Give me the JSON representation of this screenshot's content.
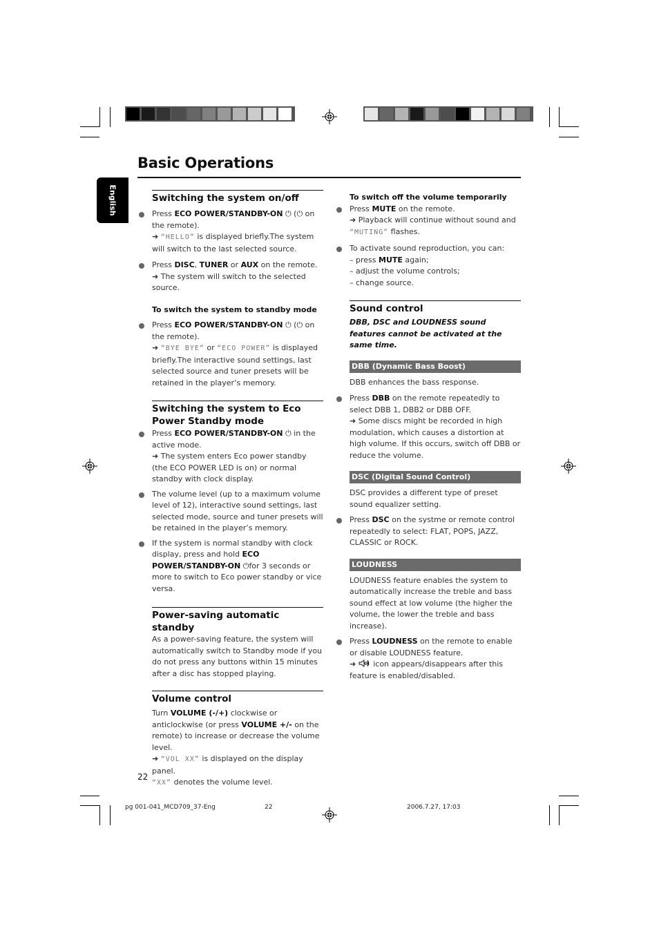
{
  "print_marks": {
    "left_swatches": [
      "#000000",
      "#1a1a1a",
      "#333333",
      "#4d4d4d",
      "#666666",
      "#808080",
      "#999999",
      "#b3b3b3",
      "#cccccc",
      "#e6e6e6",
      "#ffffff"
    ],
    "right_swatches": [
      "#e6e6e6",
      "#666666",
      "#b3b3b3",
      "#1a1a1a",
      "#999999",
      "#4d4d4d",
      "#000000",
      "#f2f2f2",
      "#b3b3b3",
      "#d9d9d9",
      "#808080"
    ]
  },
  "page": {
    "title": "Basic Operations",
    "language_tab": "English",
    "page_number": "22"
  },
  "left": {
    "s1": {
      "heading": "Switching the system on/off",
      "b1": {
        "pre": "Press ",
        "bold": "ECO POWER/STANDBY-ON",
        "post": " (",
        "post2": " on the remote).",
        "arrow": "➜",
        "lcd": "“HELLO”",
        "result": " is displayed briefly.The system will switch to the last selected source."
      },
      "b2": {
        "pre": "Press ",
        "bold1": "DISC",
        "sep1": ", ",
        "bold2": "TUNER",
        "sep2": " or ",
        "bold3": "AUX",
        "post": " on the remote.",
        "arrow": "➜",
        "result": " The system will switch to the selected source."
      },
      "sub": "To switch the system to standby mode",
      "b3": {
        "pre": "Press ",
        "bold": "ECO POWER/STANDBY-ON",
        "post": " (",
        "post2": " on the remote).",
        "arrow": "➜",
        "lcd1": "“BYE BYE”",
        "or": " or ",
        "lcd2": "“ECO POWER”",
        "result": " is displayed briefly.The interactive sound settings, last selected source and tuner presets will be retained in the player’s memory."
      }
    },
    "s2": {
      "heading": "Switching the system to Eco Power Standby mode",
      "b1": {
        "pre": "Press ",
        "bold": "ECO POWER/STANDBY-ON",
        "post": " in the active mode.",
        "arrow": "➜",
        "result": " The system enters Eco power standby (the ECO POWER LED is on) or normal standby with clock display."
      },
      "b2": "The volume level (up to a maximum volume level of 12), interactive sound settings, last selected mode, source and tuner presets will be retained in the player’s memory.",
      "b3": {
        "pre": "If the system is normal standby with clock display, press and hold ",
        "bold": "ECO POWER/STANDBY-ON",
        "post": "for 3 seconds or more to switch to Eco power standby or vice versa."
      }
    },
    "s3": {
      "heading": "Power-saving automatic standby",
      "text": "As a power-saving feature, the system will automatically switch to Standby mode if you do not press any buttons within 15 minutes after a disc has stopped playing."
    },
    "s4": {
      "heading": "Volume control",
      "pre": "Turn ",
      "bold1": "VOLUME (-/+)",
      "mid": " clockwise or anticlockwise (or press ",
      "bold2": "VOLUME +/-",
      "post": " on the remote) to increase or decrease the volume level.",
      "arrow": "➜",
      "lcd1": "“VOL XX”",
      "result": " is displayed on the display panel.",
      "lcd2": "“XX”",
      "result2": " denotes the volume level."
    }
  },
  "right": {
    "mute": {
      "sub": "To switch off the volume temporarily",
      "b1": {
        "pre": "Press ",
        "bold": "MUTE",
        "post": " on the remote.",
        "arrow": "➜",
        "result": " Playback will continue without sound and ",
        "lcd": "“MUTING”",
        "result2": " flashes."
      },
      "b2": {
        "intro": "To activate sound reproduction, you can:",
        "l1pre": "– press ",
        "l1bold": "MUTE",
        "l1post": " again;",
        "l2": "– adjust the volume  controls;",
        "l3": "– change source."
      }
    },
    "sound": {
      "heading": "Sound control",
      "note": "DBB, DSC and LOUDNESS sound features cannot be activated at the same time.",
      "dbb": {
        "bar": "DBB (Dynamic Bass Boost)",
        "desc": "DBB enhances the bass response.",
        "pre": "Press ",
        "bold": "DBB",
        "post": " on the remote repeatedly to select DBB 1, DBB2 or DBB OFF.",
        "arrow": "➜",
        "result": " Some discs might be recorded in high modulation, which causes a distortion at high volume. If this occurs, switch off DBB or reduce the volume."
      },
      "dsc": {
        "bar": "DSC (Digital Sound Control)",
        "desc": "DSC provides a different type of preset sound equalizer setting.",
        "pre": "Press ",
        "bold": "DSC",
        "post": " on the systme or remote control repeatedly to select: FLAT, POPS, JAZZ, CLASSIC or ROCK."
      },
      "loud": {
        "bar": "LOUDNESS",
        "desc": "LOUDNESS feature enables the system to automatically increase the treble and bass sound effect at low volume (the higher the volume, the lower the treble and bass increase).",
        "pre": "Press ",
        "bold": "LOUDNESS",
        "post": " on the remote to enable or disable LOUDNESS feature.",
        "arrow": "➜",
        "result": " icon appears/disappears after this feature is enabled/disabled."
      }
    }
  },
  "footer": {
    "file": "pg 001-041_MCD709_37-Eng",
    "page": "22",
    "datetime": "2006.7.27, 17:03"
  }
}
